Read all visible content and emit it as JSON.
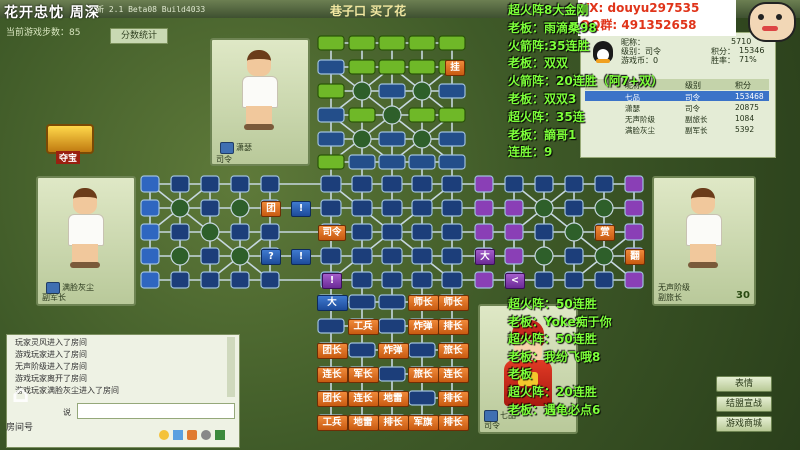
{
  "title": "花开忠忱 周深",
  "build": "新 2.1 Beta08 Build4033",
  "room_title": "巷子口 买了花",
  "steps_label": "当前游戏步数：",
  "steps_value": "85",
  "stats_button": "分数统计",
  "treasure_label": "夺宝",
  "ad_vx": "VX:  douyu297535",
  "ad_qq": "QQ群:  491352658",
  "overlay_top": [
    "超火阵8大金刚",
    "老板：雨滴桑98",
    "火箭阵:35连胜",
    "老板：双双",
    "火箭阵：20连胜（阿7+双）",
    "老板：双双3",
    "超火阵：35连",
    "老板：謫哥1",
    "连胜：9"
  ],
  "overlay_bottom": [
    "超火阵：50连胜",
    "老板：Yoke痴于你",
    "超火阵：50连胜",
    "老板：我纷飞哦8",
    "老板",
    "超火阵：20连胜",
    "老板：遇龟必点6"
  ],
  "player_info": {
    "nickname_label": "昵称：",
    "nickname_value": "5710",
    "level_label": "级别：司令",
    "score_label": "积分：",
    "score_value": "15346",
    "games_label": "游戏币：0",
    "winrate_label": "胜率：",
    "winrate_value": "71%",
    "headers": [
      "昵称",
      "级别",
      "积分"
    ],
    "rows": [
      {
        "name": "七品",
        "rank": "司令",
        "score": "153468"
      },
      {
        "name": "潇瑟",
        "rank": "司令",
        "score": "20875"
      },
      {
        "name": "无声阶级",
        "rank": "副旅长",
        "score": "1084"
      },
      {
        "name": "满脸灰尘",
        "rank": "副军长",
        "score": "5392"
      }
    ]
  },
  "players": {
    "top": {
      "rank": "司令",
      "name": "潇瑟"
    },
    "left": {
      "rank": "副军长",
      "name": "满脸灰尘"
    },
    "right": {
      "rank": "副旅长",
      "name": "无声阶级",
      "score": "30"
    },
    "bottom": {
      "rank": "司令",
      "name": "七品"
    }
  },
  "chat_messages": [
    "玩家灵风进入了房间",
    "游戏玩家进入了房间",
    "无声阶级进入了房间",
    "游戏玩家离开了房间",
    "游戏玩家满脸灰尘进入了房间"
  ],
  "chat_input_label": "说",
  "room_label": "房间号",
  "side_buttons": [
    "表情",
    "结盟宣战",
    "游戏商城"
  ],
  "bottom_pieces": [
    {
      "label": "大",
      "color": "blue"
    },
    {
      "label": "师长",
      "color": "orange"
    },
    {
      "label": "师长",
      "color": "orange"
    },
    {
      "label": "工兵",
      "color": "orange"
    },
    {
      "label": "炸弹",
      "color": "orange"
    },
    {
      "label": "排长",
      "color": "orange"
    },
    {
      "label": "团长",
      "color": "orange"
    },
    {
      "label": "炸弹",
      "color": "orange"
    },
    {
      "label": "旅长",
      "color": "orange"
    },
    {
      "label": "连长",
      "color": "orange"
    },
    {
      "label": "军长",
      "color": "orange"
    },
    {
      "label": "旅长",
      "color": "orange"
    },
    {
      "label": "连长",
      "color": "orange"
    },
    {
      "label": "团长",
      "color": "orange"
    },
    {
      "label": "连长",
      "color": "orange"
    },
    {
      "label": "地雷",
      "color": "orange"
    },
    {
      "label": "排长",
      "color": "orange"
    },
    {
      "label": "地雷",
      "color": "orange"
    },
    {
      "label": "工兵",
      "color": "orange"
    },
    {
      "label": "地雷",
      "color": "orange"
    },
    {
      "label": "排长",
      "color": "orange"
    },
    {
      "label": "军旗",
      "color": "orange"
    },
    {
      "label": "排长",
      "color": "orange"
    }
  ],
  "board_pieces": [
    {
      "label": "挂",
      "color": "orange"
    },
    {
      "label": "团",
      "color": "orange"
    },
    {
      "label": "!",
      "color": "blue"
    },
    {
      "label": "?",
      "color": "blue"
    },
    {
      "label": "!",
      "color": "blue"
    },
    {
      "label": "司令",
      "color": "orange"
    },
    {
      "label": "!",
      "color": "purple"
    },
    {
      "label": "大",
      "color": "purple"
    },
    {
      "label": "<",
      "color": "purple"
    },
    {
      "label": "赏",
      "color": "orange"
    },
    {
      "label": "翻",
      "color": "orange"
    }
  ],
  "colors": {
    "orange": "#e0741f",
    "blue": "#2f66c0",
    "purple": "#8a3fb6",
    "green": "#6fb828",
    "overlay": "#7dff3a"
  }
}
